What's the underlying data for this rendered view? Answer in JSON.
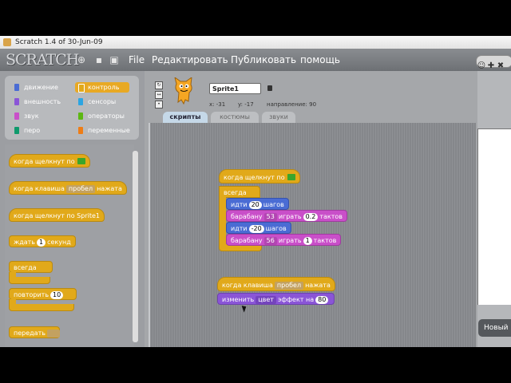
{
  "window": {
    "title": "Scratch 1.4 of 30-Jun-09"
  },
  "menubar": {
    "logo": "SCRATCH",
    "items": [
      "File",
      "Редактировать",
      "Публиковать",
      "помощь"
    ]
  },
  "categories": [
    {
      "label": "движение",
      "color": "#4a6cd4"
    },
    {
      "label": "контроль",
      "color": "#e1a91a",
      "selected": true
    },
    {
      "label": "внешность",
      "color": "#8a55d7"
    },
    {
      "label": "сенсоры",
      "color": "#2ca5e2"
    },
    {
      "label": "звук",
      "color": "#c94fc9"
    },
    {
      "label": "операторы",
      "color": "#5cb712"
    },
    {
      "label": "перо",
      "color": "#0e9a6c"
    },
    {
      "label": "переменные",
      "color": "#ee7d16"
    }
  ],
  "palette": {
    "when_flag": "когда щелкнут по",
    "when_key": "когда клавиша",
    "key_value": "пробел",
    "pressed": "нажата",
    "when_sprite_clicked": "когда щелкнут по",
    "sprite_ref": "Sprite1",
    "wait": "ждать",
    "wait_value": "1",
    "seconds": "секунд",
    "forever": "всегда",
    "repeat": "повторить",
    "repeat_value": "10",
    "broadcast": "передать"
  },
  "sprite": {
    "name": "Sprite1",
    "x_label": "x:",
    "x_value": "-31",
    "y_label": "y:",
    "y_value": "-17",
    "direction_label": "направление:",
    "direction_value": "90"
  },
  "tabs": [
    "скрипты",
    "костюмы",
    "звуки"
  ],
  "script1": {
    "hat": "когда щелкнут по",
    "forever": "всегда",
    "move1": {
      "label": "идти",
      "value": "20",
      "unit": "шагов"
    },
    "drum1": {
      "label": "барабану",
      "value": "53",
      "play": "играть",
      "beats": "0.2",
      "unit": "тактов"
    },
    "move2": {
      "label": "идти",
      "value": "-20",
      "unit": "шагов"
    },
    "drum2": {
      "label": "барабану",
      "value": "56",
      "play": "играть",
      "beats": "1",
      "unit": "тактов"
    }
  },
  "script2": {
    "hat": "когда клавиша",
    "key": "пробел",
    "pressed": "нажата",
    "change": "изменить",
    "effect": "цвет",
    "effect_label": "эффект на",
    "value": "80"
  },
  "stage": {
    "new_sprite": "Новый"
  }
}
